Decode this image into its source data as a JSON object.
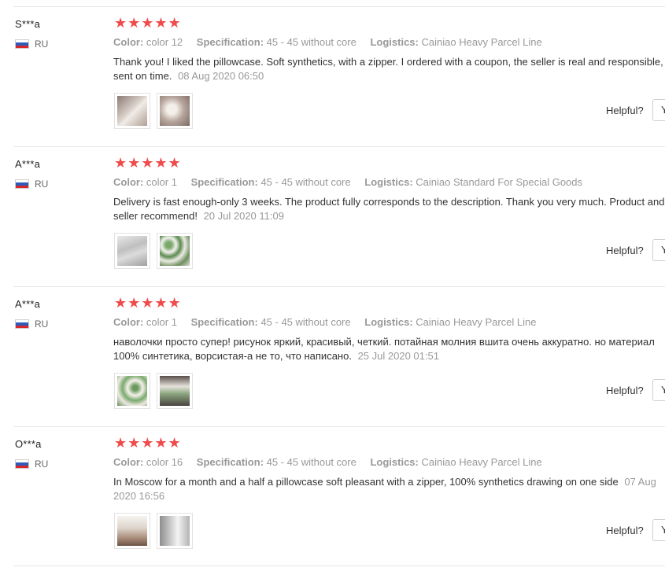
{
  "labels": {
    "color": "Color:",
    "specification": "Specification:",
    "logistics": "Logistics:",
    "helpful": "Helpful?",
    "yes_button": "Y"
  },
  "rating_color": "#f04b4b",
  "reviews": [
    {
      "user": "S***a",
      "country": "RU",
      "stars": "★★★★★",
      "rating": 5,
      "color": "color 12",
      "specification": "45 - 45 without core",
      "logistics": "Cainiao Heavy Parcel Line",
      "text": "Thank you! I liked the pillowcase. Soft synthetics, with a zipper. I ordered with a coupon, the seller is real and responsible, sent on time.",
      "date": "08 Aug 2020 06:50"
    },
    {
      "user": "A***a",
      "country": "RU",
      "stars": "★★★★★",
      "rating": 5,
      "color": "color 1",
      "specification": "45 - 45 without core",
      "logistics": "Cainiao Standard For Special Goods",
      "text": "Delivery is fast enough-only 3 weeks. The product fully corresponds to the description. Thank you very much. Product and seller recommend!",
      "date": "20 Jul 2020 11:09"
    },
    {
      "user": "A***a",
      "country": "RU",
      "stars": "★★★★★",
      "rating": 5,
      "color": "color 1",
      "specification": "45 - 45 without core",
      "logistics": "Cainiao Heavy Parcel Line",
      "text": "наволочки просто супер! рисунок яркий, красивый, четкий. потайная молния вшита очень аккуратно. но материал 100% синтетика, ворсистая-а не то, что написано.",
      "date": "25 Jul 2020 01:51"
    },
    {
      "user": "O***a",
      "country": "RU",
      "stars": "★★★★★",
      "rating": 5,
      "color": "color 16",
      "specification": "45 - 45 without core",
      "logistics": "Cainiao Heavy Parcel Line",
      "text": "In Moscow for a month and a half a pillowcase soft pleasant with a zipper, 100% synthetics drawing on one side",
      "date": "07 Aug 2020 16:56"
    }
  ]
}
